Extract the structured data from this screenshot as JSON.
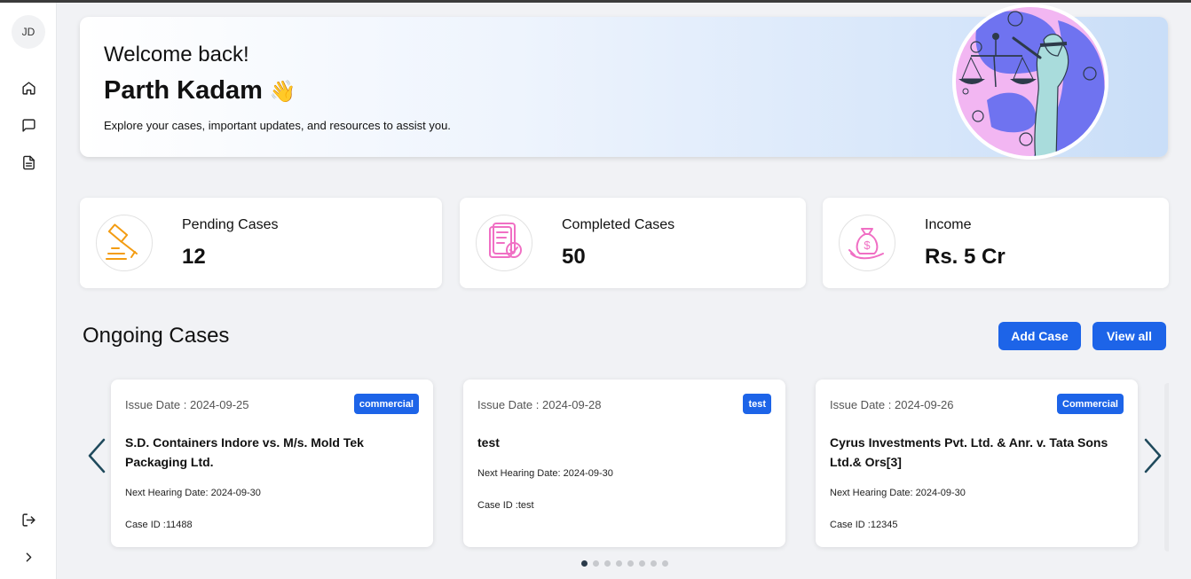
{
  "sidebar": {
    "avatar_initials": "JD",
    "icons": [
      "home-icon",
      "chat-icon",
      "document-icon",
      "logout-icon",
      "chevron-right-icon"
    ]
  },
  "banner": {
    "greeting": "Welcome back!",
    "name": "Parth Kadam",
    "wave_emoji": "👋",
    "subtitle": "Explore your cases, important updates, and resources to assist you."
  },
  "stats": [
    {
      "label": "Pending Cases",
      "value": "12",
      "icon": "gavel-icon",
      "color": "#f39c12"
    },
    {
      "label": "Completed Cases",
      "value": "50",
      "icon": "checklist-icon",
      "color": "#f06fc4"
    },
    {
      "label": "Income",
      "value": "Rs. 5 Cr",
      "icon": "money-bag-icon",
      "color": "#f06fc4"
    }
  ],
  "ongoing": {
    "title": "Ongoing Cases",
    "add_button": "Add Case",
    "view_all_button": "View all",
    "cases": [
      {
        "issue_date": "Issue Date : 2024-09-25",
        "tag": "commercial",
        "title": "S.D. Containers Indore vs. M/s. Mold Tek Packaging Ltd.",
        "hearing": "Next Hearing Date: 2024-09-30",
        "case_id": "Case ID :11488"
      },
      {
        "issue_date": "Issue Date : 2024-09-28",
        "tag": "test",
        "title": "test",
        "hearing": "Next Hearing Date: 2024-09-30",
        "case_id": "Case ID :test"
      },
      {
        "issue_date": "Issue Date : 2024-09-26",
        "tag": "Commercial",
        "title": "Cyrus Investments Pvt. Ltd. & Anr. v. Tata Sons Ltd.& Ors[3]",
        "hearing": "Next Hearing Date: 2024-09-30",
        "case_id": "Case ID :12345"
      }
    ],
    "pagination": {
      "total_pages": 8,
      "current_page": 1
    }
  },
  "colors": {
    "primary": "#1d64e8",
    "background": "#f1f2f5",
    "arrow": "#1f4a5c"
  }
}
